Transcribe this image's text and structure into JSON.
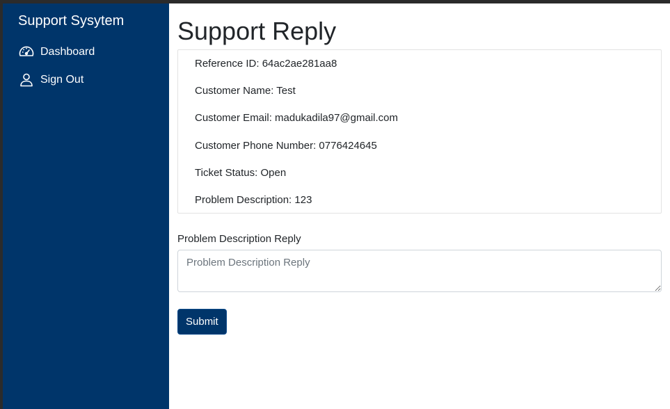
{
  "sidebar": {
    "brand": "Support Sysytem",
    "items": [
      {
        "label": "Dashboard",
        "icon": "speedometer-icon"
      },
      {
        "label": "Sign Out",
        "icon": "person-icon"
      }
    ]
  },
  "main": {
    "title": "Support Reply",
    "details": [
      "Reference ID: 64ac2ae281aa8",
      "Customer Name: Test",
      "Customer Email: madukadila97@gmail.com",
      "Customer Phone Number: 0776424645",
      "Ticket Status: Open",
      "Problem Description: 123"
    ],
    "reply": {
      "label": "Problem Description Reply",
      "placeholder": "Problem Description Reply",
      "value": ""
    },
    "submit_label": "Submit"
  },
  "colors": {
    "sidebar_bg": "#00356a",
    "button_bg": "#00356a",
    "window_border": "#2b2b2b"
  }
}
